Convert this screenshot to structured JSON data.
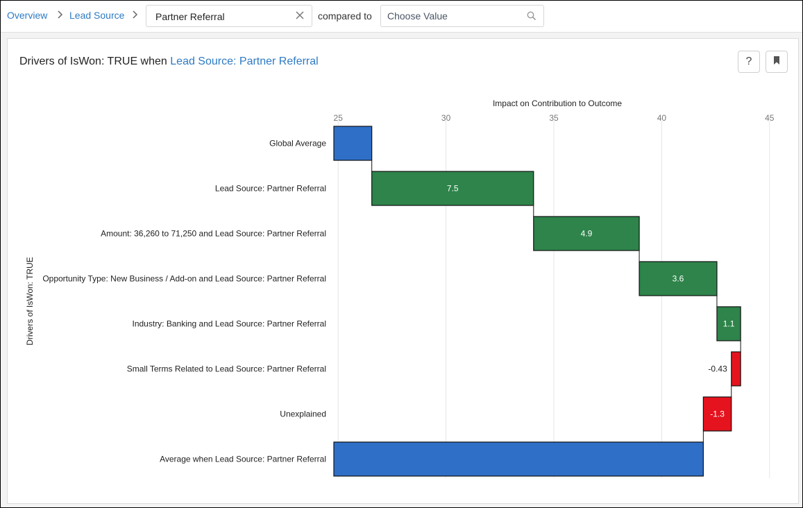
{
  "topbar": {
    "breadcrumb": [
      {
        "label": "Overview"
      },
      {
        "label": "Lead Source"
      }
    ],
    "filter_value": "Partner Referral",
    "compared_label": "compared to",
    "compare_placeholder": "Choose Value",
    "compare_value": "",
    "icons": {
      "separator": "chevron-right-icon",
      "clear": "close-icon",
      "search": "search-icon"
    }
  },
  "card": {
    "title_prefix": "Drivers of IsWon: TRUE when",
    "title_highlight": "Lead Source: Partner Referral",
    "help_label": "?",
    "icons": {
      "help": "question-mark-icon",
      "bookmark": "bookmark-icon"
    }
  },
  "colors": {
    "base_bar": "#2f6fc7",
    "positive_bar": "#2e844a",
    "negative_bar": "#e5131e",
    "link": "#2d7ac4"
  },
  "chart_data": {
    "type": "bar",
    "subtype": "waterfall-horizontal",
    "title": "Impact on Contribution to Outcome",
    "xlabel": "Impact on Contribution to Outcome",
    "ylabel": "Drivers of IsWon: TRUE",
    "xlim": [
      24.8,
      45.2
    ],
    "xticks": [
      25,
      30,
      35,
      40,
      45
    ],
    "grid": true,
    "axis_position": "top",
    "categories": [
      "Global Average",
      "Lead Source: Partner Referral",
      "Amount: 36,260 to 71,250 and Lead Source: Partner Referral",
      "Opportunity Type: New Business / Add-on and Lead Source: Partner Referral",
      "Industry: Banking and Lead Source: Partner Referral",
      "Small Terms Related to Lead Source: Partner Referral",
      "Unexplained",
      "Average when Lead Source: Partner Referral"
    ],
    "bars": [
      {
        "kind": "total",
        "value": 26.56,
        "label": ""
      },
      {
        "kind": "delta",
        "value": 7.5,
        "label": "7.5"
      },
      {
        "kind": "delta",
        "value": 4.9,
        "label": "4.9"
      },
      {
        "kind": "delta",
        "value": 3.6,
        "label": "3.6"
      },
      {
        "kind": "delta",
        "value": 1.1,
        "label": "1.1"
      },
      {
        "kind": "delta",
        "value": -0.43,
        "label": "-0.43"
      },
      {
        "kind": "delta",
        "value": -1.3,
        "label": "-1.3"
      },
      {
        "kind": "total",
        "value": 41.93,
        "label": ""
      }
    ]
  }
}
